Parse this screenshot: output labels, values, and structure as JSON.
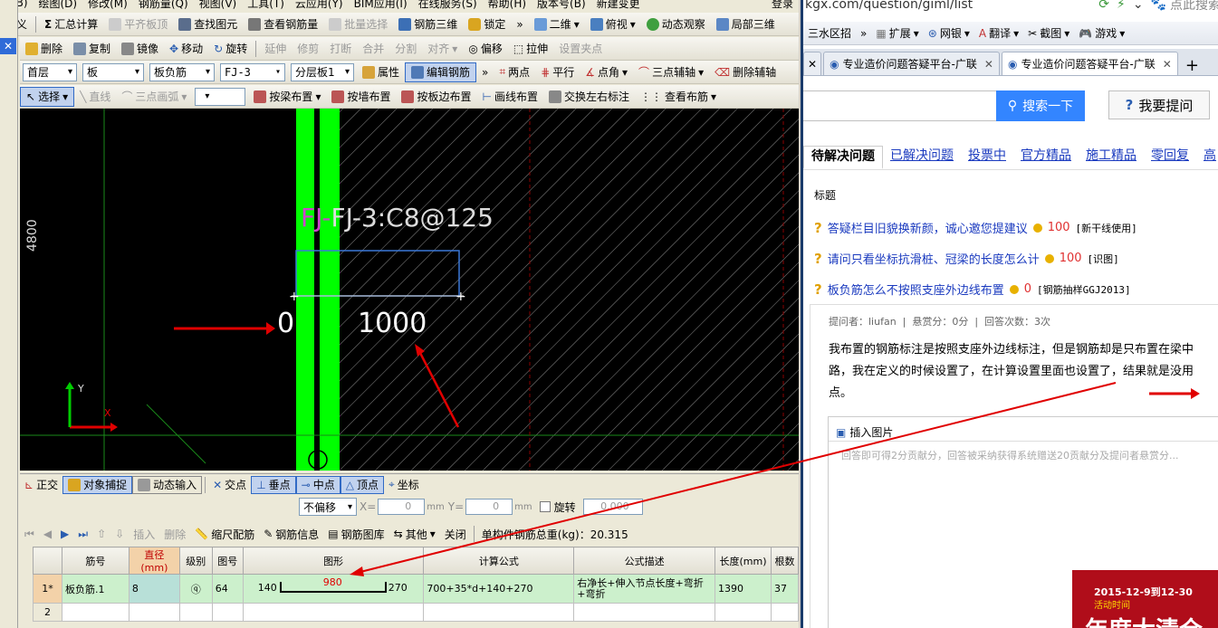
{
  "cad": {
    "menu": [
      "F(B)",
      "绘图(D)",
      "修改(M)",
      "钢筋量(Q)",
      "视图(V)",
      "工具(T)",
      "云应用(Y)",
      "BIM应用(I)",
      "在线服务(S)",
      "帮助(H)",
      "版本号(B)",
      "新建变更",
      "登录"
    ],
    "toolbar1": [
      "定义",
      "汇总计算",
      "平齐板顶",
      "查找图元",
      "查看钢筋量",
      "批量选择",
      "钢筋三维",
      "锁定",
      "二维",
      "俯视",
      "动态观察",
      "局部三维"
    ],
    "toolbar2": [
      "删除",
      "复制",
      "镜像",
      "移动",
      "旋转",
      "延伸",
      "修剪",
      "打断",
      "合并",
      "分割",
      "对齐",
      "偏移",
      "拉伸",
      "设置夹点"
    ],
    "selectors": {
      "floor": "首层",
      "type": "板",
      "subtype": "板负筋",
      "name": "FJ-3",
      "layer": "分层板1"
    },
    "toolbar3_buttons": [
      "属性",
      "编辑钢筋",
      "两点",
      "平行",
      "点角",
      "三点辅轴",
      "删除辅轴"
    ],
    "toolbar4": [
      "选择",
      "直线",
      "三点画弧",
      "按梁布置",
      "按墙布置",
      "按板边布置",
      "画线布置",
      "交换左右标注",
      "查看布筋"
    ],
    "canvas": {
      "axis_label": "4800",
      "rebar_label": "FJ-3:C8@125",
      "dim_left": "0",
      "dim_right": "1000",
      "axis_x": "X",
      "axis_y": "Y"
    },
    "status_items": [
      "正交",
      "对象捕捉",
      "动态输入",
      "交点",
      "垂点",
      "中点",
      "顶点",
      "坐标"
    ],
    "offset": {
      "mode": "不偏移",
      "x_label": "X=",
      "x_value": "0",
      "y_label": "Y=",
      "y_value": "0",
      "unit": "mm",
      "rotate_label": "旋转",
      "rotate_value": "0.000"
    },
    "table_toolbar": [
      "插入",
      "删除",
      "缩尺配筋",
      "钢筋信息",
      "钢筋图库",
      "其他",
      "关闭"
    ],
    "total_label": "单构件钢筋总重(kg)：20.315",
    "table": {
      "headers": [
        "筋号",
        "直径(mm)",
        "级别",
        "图号",
        "图形",
        "计算公式",
        "公式描述",
        "长度(mm)",
        "根数"
      ],
      "rows": [
        {
          "no": "1*",
          "name": "板负筋.1",
          "diameter": "8",
          "grade": "ⓠ",
          "fig": "64",
          "shape_left": "140",
          "shape_mid": "980",
          "shape_right": "270",
          "formula": "700+35*d+140+270",
          "desc": "右净长+伸入节点长度+弯折+弯折",
          "length": "1390",
          "count": "37"
        },
        {
          "no": "2",
          "name": "",
          "diameter": "",
          "grade": "",
          "fig": "",
          "shape_left": "",
          "shape_mid": "",
          "shape_right": "",
          "formula": "",
          "desc": "",
          "length": "",
          "count": ""
        }
      ]
    }
  },
  "browser": {
    "address": "kgx.com/question/giml/list",
    "search_placeholder": "点此搜索",
    "fav_items": [
      "三水区招",
      "扩展",
      "网银",
      "翻译",
      "截图",
      "游戏"
    ],
    "tabs": [
      "专业造价问题答疑平台-广联",
      "专业造价问题答疑平台-广联"
    ],
    "search_button": "搜索一下",
    "ask_button": "我要提问",
    "question_tabs": [
      "待解决问题",
      "已解决问题",
      "投票中",
      "官方精品",
      "施工精品",
      "零回复",
      "高"
    ],
    "list_header": "标题",
    "questions": [
      {
        "title": "答疑栏目旧貌换新颜，诚心邀您提建议",
        "score": "100",
        "tag": "[新干线使用]"
      },
      {
        "title": "请问只看坐标抗滑桩、冠梁的长度怎么计",
        "score": "100",
        "tag": "[识图]"
      },
      {
        "title": "板负筋怎么不按照支座外边线布置",
        "score": "0",
        "tag": "[钢筋抽样GGJ2013]"
      }
    ],
    "meta": "提问者：liufan  |  悬赏分：0分  |  回答次数：3次",
    "body_line1": "我布置的钢筋标注是按照支座外边线标注，但是钢筋却是只布置在梁中",
    "body_line2": "路，我在定义的时候设置了，在计算设置里面也设置了，结果就是没用",
    "body_line3": "点。",
    "insert_image": "插入图片",
    "editor_placeholder": "回答即可得2分贡献分，回答被采纳获得系统赠送20贡献分及提问者悬赏分...",
    "promo_date": "2015-12-9到12-30",
    "promo_sub": "活动时间",
    "promo_big": "年度大清仓"
  },
  "colors": {
    "accent": "#316ac5",
    "canvas_bg": "#000000",
    "slab_green": "#00ff00",
    "row_green": "#ccf0cc",
    "annot_red": "#e00000"
  }
}
